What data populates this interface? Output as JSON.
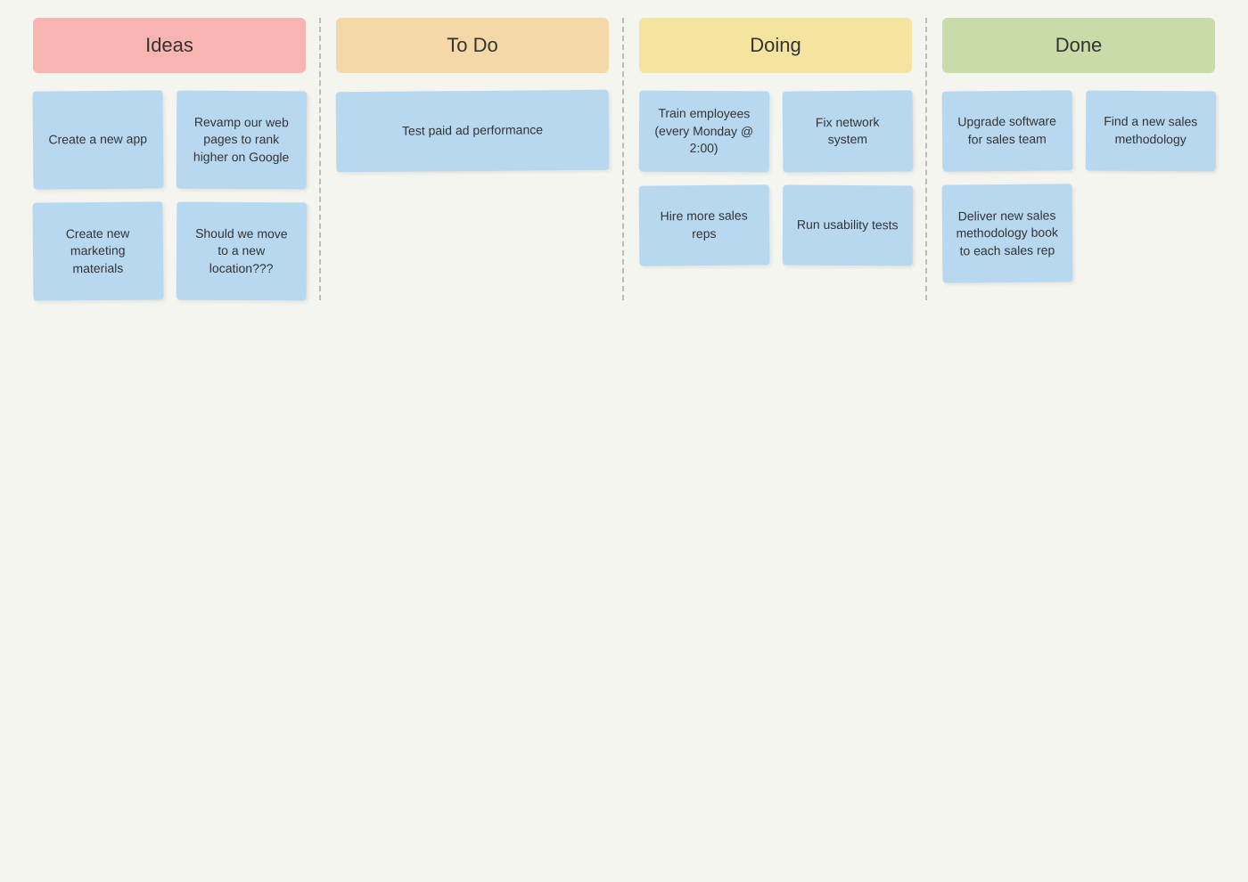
{
  "columns": [
    {
      "id": "ideas",
      "label": "Ideas",
      "headerClass": "header-ideas",
      "cards": [
        {
          "id": "idea-1",
          "text": "Create a new app",
          "col": 1
        },
        {
          "id": "idea-2",
          "text": "Revamp our web pages to rank higher on Google",
          "col": 2
        },
        {
          "id": "idea-3",
          "text": "Create new marketing materials",
          "col": 1
        },
        {
          "id": "idea-4",
          "text": "Should we move to a new location???",
          "col": 2
        }
      ]
    },
    {
      "id": "todo",
      "label": "To Do",
      "headerClass": "header-todo",
      "cards": [
        {
          "id": "todo-1",
          "text": "Test paid ad performance"
        }
      ]
    },
    {
      "id": "doing",
      "label": "Doing",
      "headerClass": "header-doing",
      "cards": [
        {
          "id": "doing-1",
          "text": "Train employees (every Monday @ 2:00)",
          "col": 1
        },
        {
          "id": "doing-2",
          "text": "Fix network system",
          "col": 2
        },
        {
          "id": "doing-3",
          "text": "Hire more sales reps",
          "col": 1
        },
        {
          "id": "doing-4",
          "text": "Run usability tests",
          "col": 2
        }
      ]
    },
    {
      "id": "done",
      "label": "Done",
      "headerClass": "header-done",
      "cards": [
        {
          "id": "done-1",
          "text": "Upgrade software for sales team",
          "col": 1
        },
        {
          "id": "done-2",
          "text": "Find a new sales methodology",
          "col": 2
        },
        {
          "id": "done-3",
          "text": "Deliver new sales methodology book to each sales rep",
          "col": 1
        }
      ]
    }
  ]
}
